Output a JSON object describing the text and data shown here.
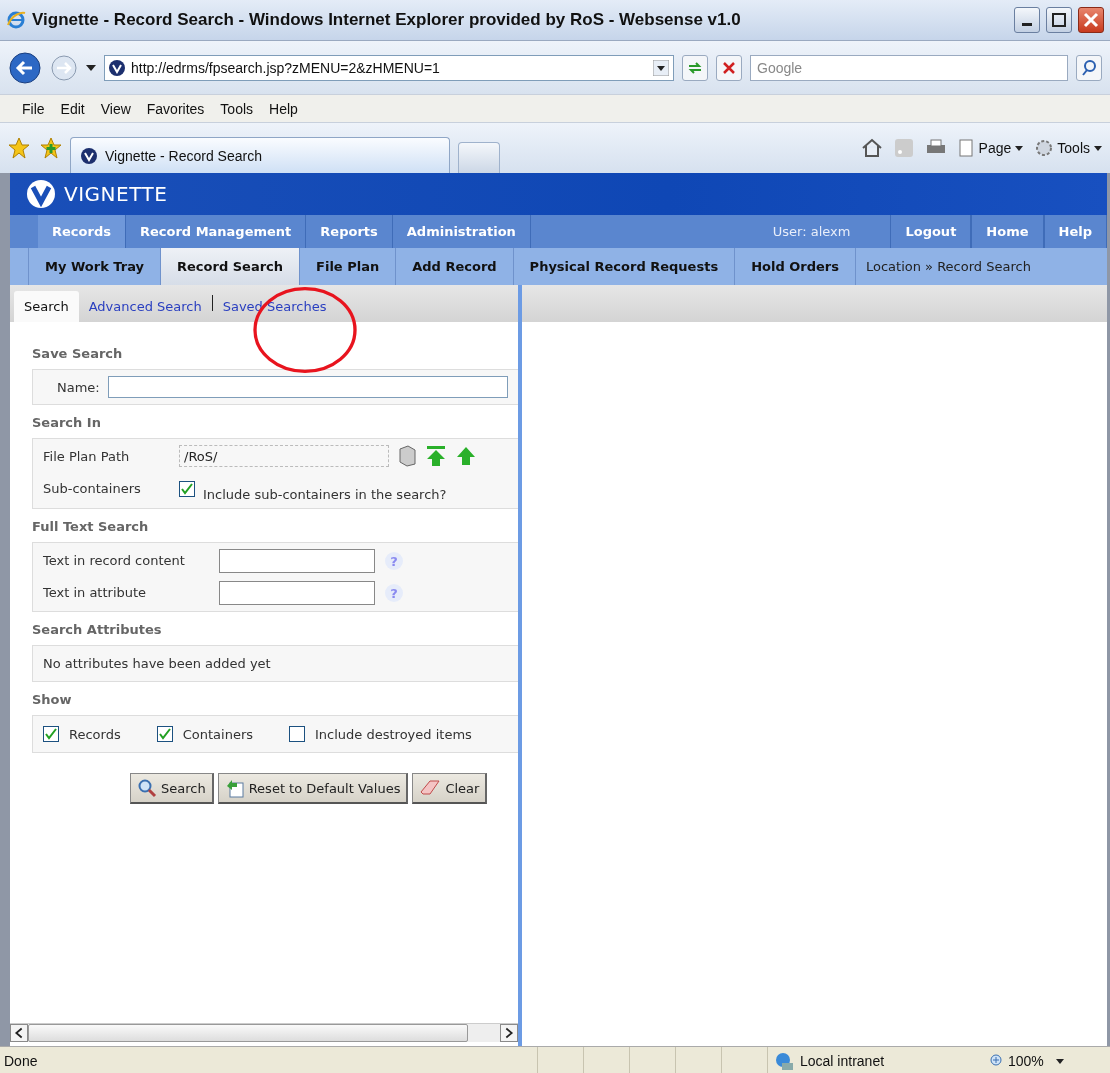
{
  "window": {
    "title": "Vignette - Record Search - Windows Internet Explorer provided by RoS - Websense v1.0"
  },
  "address_bar": {
    "url": "http://edrms/fpsearch.jsp?zMENU=2&zHMENU=1",
    "search_placeholder": "Google"
  },
  "menu": [
    "File",
    "Edit",
    "View",
    "Favorites",
    "Tools",
    "Help"
  ],
  "browser_tab": {
    "title": "Vignette - Record Search"
  },
  "command_bar": [
    "Page",
    "Tools"
  ],
  "app": {
    "logo": "VIGNETTE",
    "main_nav": [
      {
        "label": "Records",
        "selected": true
      },
      {
        "label": "Record Management",
        "selected": false
      },
      {
        "label": "Reports",
        "selected": false
      },
      {
        "label": "Administration",
        "selected": false
      }
    ],
    "user": "User: alexm",
    "links": [
      "Logout",
      "Home",
      "Help"
    ],
    "sub_nav": [
      {
        "label": "My Work Tray",
        "selected": false
      },
      {
        "label": "Record Search",
        "selected": true
      },
      {
        "label": "File Plan",
        "selected": false
      },
      {
        "label": "Add Record",
        "selected": false
      },
      {
        "label": "Physical Record Requests",
        "selected": false
      },
      {
        "label": "Hold Orders",
        "selected": false
      }
    ],
    "breadcrumb": "Location » Record Search"
  },
  "search_tabs": [
    {
      "label": "Search",
      "selected": true
    },
    {
      "label": "Advanced Search",
      "selected": false
    },
    {
      "label": "Saved Searches",
      "selected": false
    }
  ],
  "save_search": {
    "heading": "Save Search",
    "name_label": "Name:"
  },
  "search_in": {
    "heading": "Search In",
    "path_label": "File Plan Path",
    "path": "/RoS/",
    "sub_label": "Sub-containers",
    "sub_text": "Include sub-containers in the search?",
    "sub_checked": true
  },
  "full_text": {
    "heading": "Full Text Search",
    "fields": [
      {
        "label": "Text in record content",
        "help": "?"
      },
      {
        "label": "Text in attribute",
        "help": "?"
      }
    ]
  },
  "attributes": {
    "heading": "Search Attributes",
    "text": "No attributes have been added yet"
  },
  "show": {
    "heading": "Show",
    "options": [
      {
        "label": "Records",
        "checked": true
      },
      {
        "label": "Containers",
        "checked": true
      },
      {
        "label": "Include destroyed items",
        "checked": false
      }
    ]
  },
  "buttons": [
    {
      "kind": "search",
      "label": "Search"
    },
    {
      "kind": "reset",
      "label": "Reset to Default Values"
    },
    {
      "kind": "clear",
      "label": "Clear"
    }
  ],
  "status_bar": {
    "text": "Done",
    "zone": "Local intranet",
    "zoom": "100%"
  }
}
